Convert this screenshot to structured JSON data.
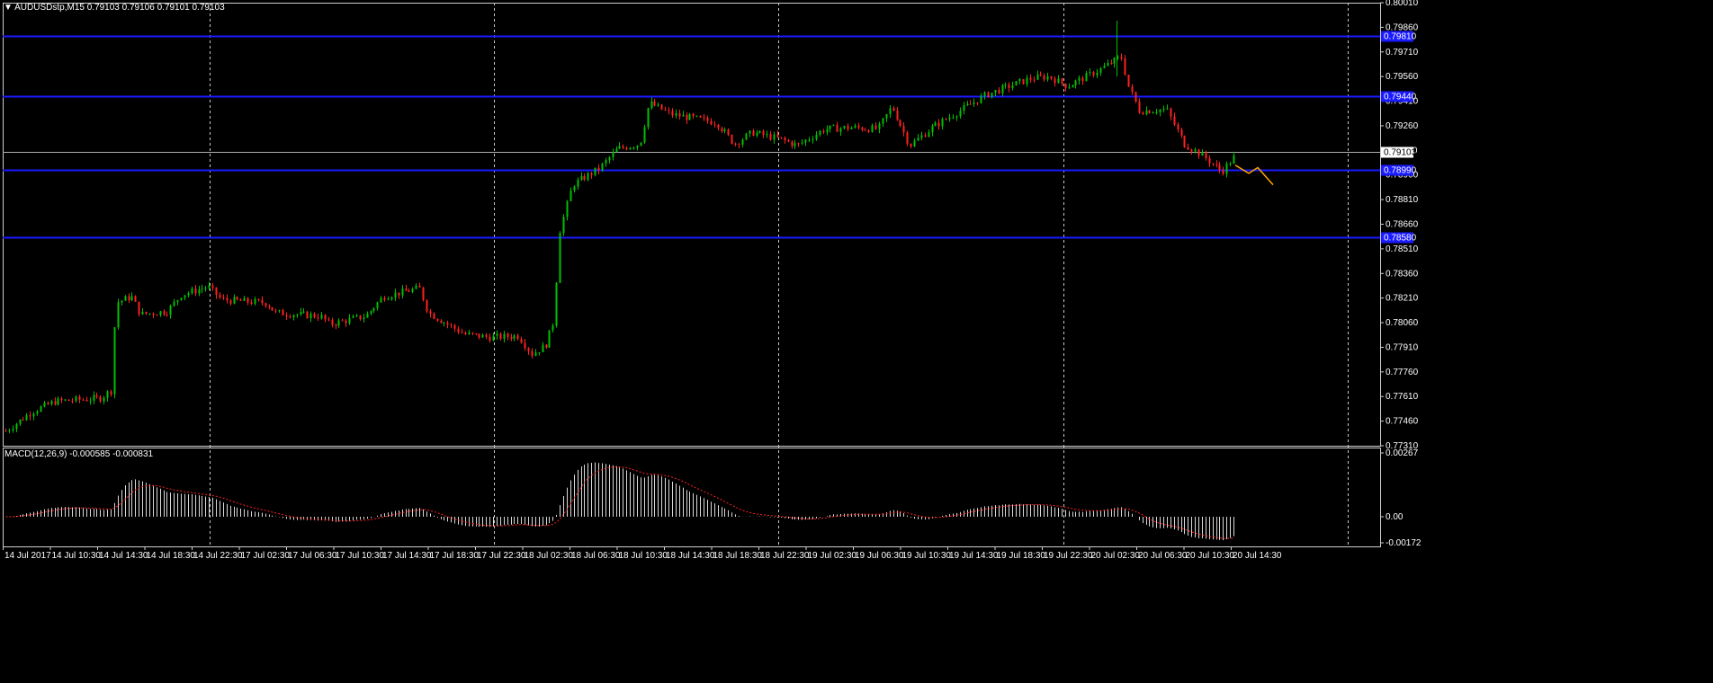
{
  "symbol_header": "AUDUSDstp,M15  0.79103 0.79106 0.79101 0.79103",
  "price_panel": {
    "y_ticks": [
      "0.80010",
      "0.79860",
      "0.79710",
      "0.79560",
      "0.79410",
      "0.79260",
      "0.79110",
      "0.78960",
      "0.78810",
      "0.78660",
      "0.78510",
      "0.78360",
      "0.78210",
      "0.78060",
      "0.77910",
      "0.77760",
      "0.77610",
      "0.77460",
      "0.77310"
    ],
    "current_price_label": "0.79103",
    "current_price": 0.79103,
    "hlines": [
      {
        "price": 0.7981,
        "label": "0.79810"
      },
      {
        "price": 0.7944,
        "label": "0.79440"
      },
      {
        "price": 0.7899,
        "label": "0.78990"
      },
      {
        "price": 0.7858,
        "label": "0.78580"
      }
    ],
    "hline_color": "#1a1aff",
    "up_color": "#00c000",
    "down_color": "#ff2020",
    "forecast_color": "#ffa500"
  },
  "macd_panel": {
    "title": "MACD(12,26,9) -0.000585 -0.000831",
    "y_ticks": [
      "0.00267",
      "0.00",
      "-0.00172"
    ]
  },
  "time_axis": [
    "14 Jul 2017",
    "14 Jul 10:30",
    "14 Jul 14:30",
    "14 Jul 18:30",
    "14 Jul 22:30",
    "17 Jul 02:30",
    "17 Jul 06:30",
    "17 Jul 10:30",
    "17 Jul 14:30",
    "17 Jul 18:30",
    "17 Jul 22:30",
    "18 Jul 02:30",
    "18 Jul 06:30",
    "18 Jul 10:30",
    "18 Jul 14:30",
    "18 Jul 18:30",
    "18 Jul 22:30",
    "19 Jul 02:30",
    "19 Jul 06:30",
    "19 Jul 10:30",
    "19 Jul 14:30",
    "19 Jul 18:30",
    "19 Jul 22:30",
    "20 Jul 02:30",
    "20 Jul 06:30",
    "20 Jul 10:30",
    "20 Jul 14:30"
  ],
  "chart_data": {
    "type": "candlestick",
    "symbol": "AUDUSDstp",
    "timeframe": "M15",
    "ylim": [
      0.7731,
      0.8001
    ],
    "anchors": [
      [
        0,
        0.774
      ],
      [
        30,
        0.7752
      ],
      [
        55,
        0.7758
      ],
      [
        105,
        0.776
      ],
      [
        118,
        0.7765
      ],
      [
        122,
        0.7818
      ],
      [
        140,
        0.7822
      ],
      [
        150,
        0.7811
      ],
      [
        180,
        0.7813
      ],
      [
        195,
        0.7823
      ],
      [
        225,
        0.7828
      ],
      [
        240,
        0.782
      ],
      [
        290,
        0.7818
      ],
      [
        300,
        0.7812
      ],
      [
        350,
        0.781
      ],
      [
        360,
        0.7805
      ],
      [
        400,
        0.781
      ],
      [
        420,
        0.7822
      ],
      [
        460,
        0.7827
      ],
      [
        470,
        0.7812
      ],
      [
        510,
        0.7799
      ],
      [
        540,
        0.7797
      ],
      [
        570,
        0.7798
      ],
      [
        585,
        0.7787
      ],
      [
        600,
        0.7792
      ],
      [
        610,
        0.7808
      ],
      [
        615,
        0.786
      ],
      [
        630,
        0.789
      ],
      [
        660,
        0.79
      ],
      [
        680,
        0.7912
      ],
      [
        705,
        0.7915
      ],
      [
        715,
        0.794
      ],
      [
        740,
        0.7933
      ],
      [
        790,
        0.7928
      ],
      [
        810,
        0.7915
      ],
      [
        830,
        0.7922
      ],
      [
        860,
        0.7918
      ],
      [
        880,
        0.7914
      ],
      [
        910,
        0.7924
      ],
      [
        940,
        0.7925
      ],
      [
        970,
        0.7924
      ],
      [
        985,
        0.7938
      ],
      [
        1005,
        0.7914
      ],
      [
        1030,
        0.7925
      ],
      [
        1060,
        0.7935
      ],
      [
        1090,
        0.7945
      ],
      [
        1140,
        0.7955
      ],
      [
        1160,
        0.7956
      ],
      [
        1180,
        0.795
      ],
      [
        1215,
        0.796
      ],
      [
        1240,
        0.7968
      ],
      [
        1248,
        0.795
      ],
      [
        1260,
        0.7935
      ],
      [
        1290,
        0.7936
      ],
      [
        1310,
        0.7915
      ],
      [
        1330,
        0.7908
      ],
      [
        1352,
        0.7898
      ],
      [
        1370,
        0.791
      ]
    ]
  }
}
